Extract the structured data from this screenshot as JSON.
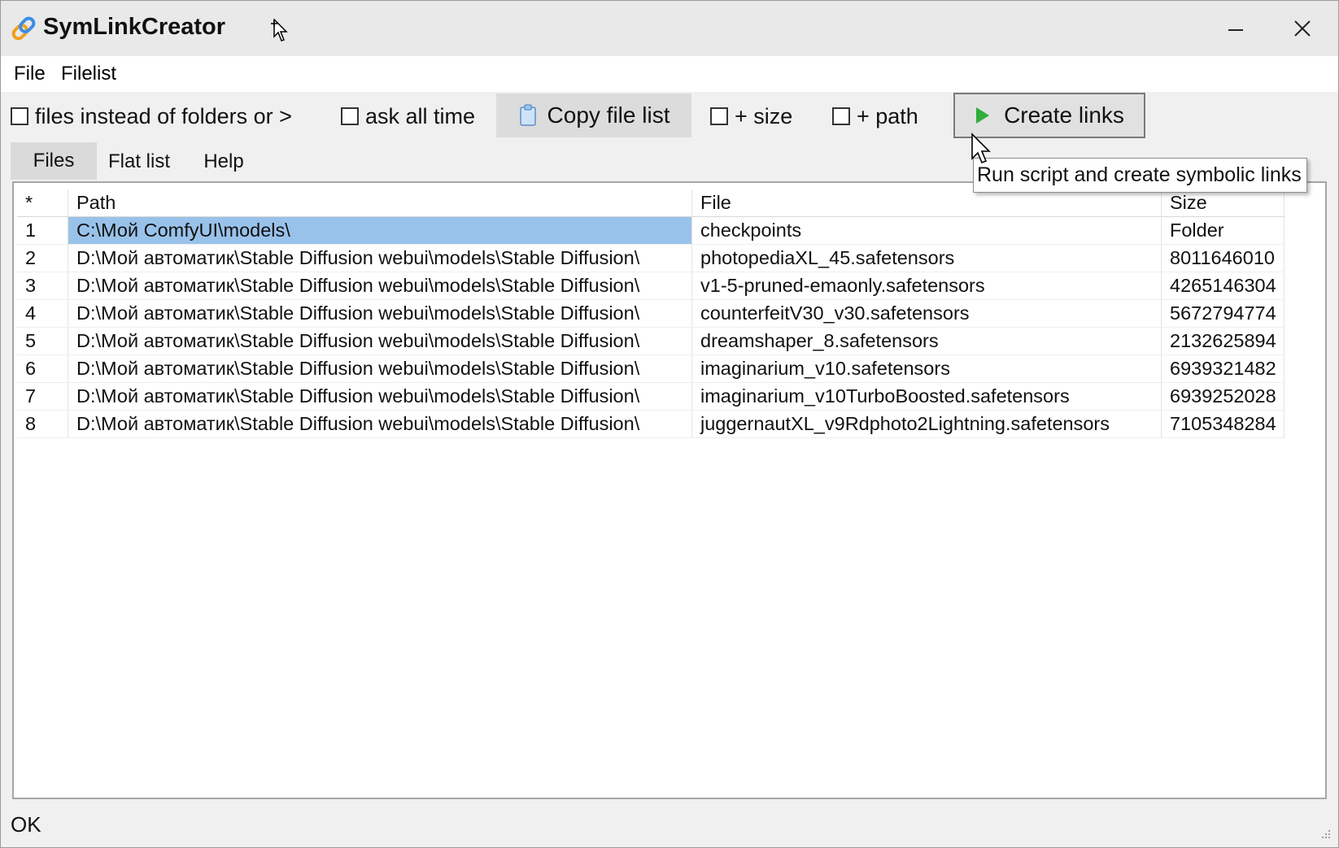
{
  "window": {
    "title": "SymLinkCreator",
    "minimize_glyph": "—",
    "close_glyph": "✕",
    "icon": "link-icon"
  },
  "menu": {
    "items": [
      "File",
      "Filelist"
    ]
  },
  "toolbar": {
    "files_instead_label": "files instead of folders or >",
    "ask_all_time_label": "ask all time",
    "copy_file_list_label": "Copy file list",
    "plus_size_label": "+ size",
    "plus_path_label": "+ path",
    "create_links_label": "Create links",
    "files_instead_checked": false,
    "ask_all_time_checked": false,
    "plus_size_checked": false,
    "plus_path_checked": false
  },
  "tabs": [
    "Files",
    "Flat list",
    "Help"
  ],
  "active_tab": "Files",
  "grid": {
    "columns": [
      "*",
      "Path",
      "File",
      "Size"
    ],
    "rows": [
      {
        "n": "1",
        "path": "C:\\Мой ComfyUI\\models\\",
        "file": "checkpoints",
        "size": "Folder"
      },
      {
        "n": "2",
        "path": "D:\\Мой автоматик\\Stable Diffusion webui\\models\\Stable Diffusion\\",
        "file": "photopediaXL_45.safetensors",
        "size": "8011646010"
      },
      {
        "n": "3",
        "path": "D:\\Мой автоматик\\Stable Diffusion webui\\models\\Stable Diffusion\\",
        "file": "v1-5-pruned-emaonly.safetensors",
        "size": "4265146304"
      },
      {
        "n": "4",
        "path": "D:\\Мой автоматик\\Stable Diffusion webui\\models\\Stable Diffusion\\",
        "file": "counterfeitV30_v30.safetensors",
        "size": "5672794774"
      },
      {
        "n": "5",
        "path": "D:\\Мой автоматик\\Stable Diffusion webui\\models\\Stable Diffusion\\",
        "file": "dreamshaper_8.safetensors",
        "size": "2132625894"
      },
      {
        "n": "6",
        "path": "D:\\Мой автоматик\\Stable Diffusion webui\\models\\Stable Diffusion\\",
        "file": "imaginarium_v10.safetensors",
        "size": "6939321482"
      },
      {
        "n": "7",
        "path": "D:\\Мой автоматик\\Stable Diffusion webui\\models\\Stable Diffusion\\",
        "file": "imaginarium_v10TurboBoosted.safetensors",
        "size": "6939252028"
      },
      {
        "n": "8",
        "path": "D:\\Мой автоматик\\Stable Diffusion webui\\models\\Stable Diffusion\\",
        "file": "juggernautXL_v9Rdphoto2Lightning.safetensors",
        "size": "7105348284"
      }
    ],
    "selected_row": 0
  },
  "tooltip": {
    "text": "Run script and create symbolic links"
  },
  "status": {
    "text": "OK"
  },
  "colors": {
    "selection": "#99c2ea",
    "play_icon": "#2fae3a",
    "window_bg": "#f0f0f0"
  }
}
